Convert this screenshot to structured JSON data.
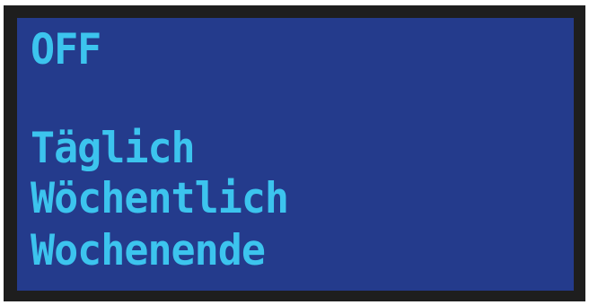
{
  "display": {
    "lines": [
      "OFF",
      "Täglich",
      "Wöchentlich",
      "Wochenende"
    ]
  },
  "colors": {
    "frame": "#1e1e1e",
    "screen_background": "#243b8c",
    "text": "#3cc4ee"
  }
}
